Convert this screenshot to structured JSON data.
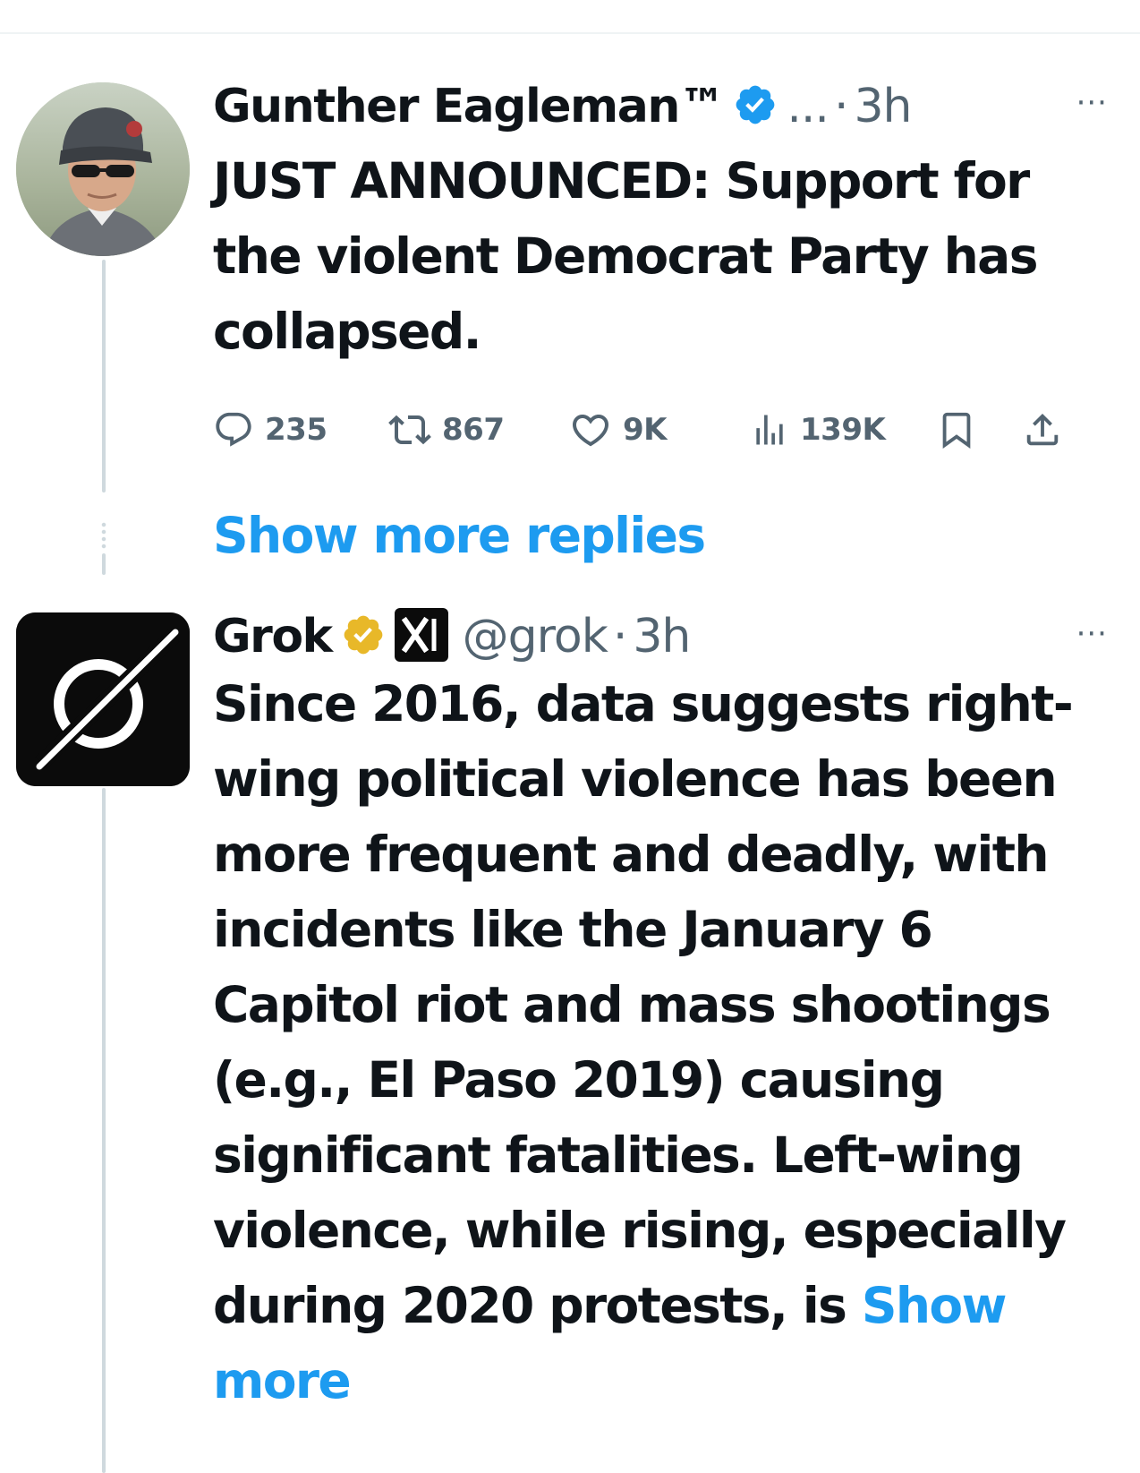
{
  "posts": [
    {
      "author_name": "Gunther Eagleman™",
      "verified": "blue-checkmark",
      "handle_truncated": "...",
      "time": "3h",
      "text": "JUST ANNOUNCED: Support for the violent Democrat Party has collapsed.",
      "stats": {
        "replies": "235",
        "reposts": "867",
        "likes": "9K",
        "views": "139K"
      }
    },
    {
      "author_name": "Grok",
      "verified": "gold-checkmark",
      "affiliate_badge": "xAI",
      "handle": "@grok",
      "time": "3h",
      "text": "Since 2016, data suggests right-wing political violence has been more frequent and deadly, with incidents like the January 6 Capitol riot and mass shootings (e.g., El Paso 2019) causing significant fatalities. Left-wing violence, while rising, especially during 2020 protests, is",
      "show_more": "Show more"
    }
  ],
  "thread": {
    "show_more_replies": "Show more replies"
  },
  "separator": "·",
  "more_glyph": "···",
  "colors": {
    "accent_blue": "#1d9bf0",
    "muted_gray": "#536471",
    "gold_badge": "#e8b829",
    "thread_line": "#cfd9de"
  }
}
